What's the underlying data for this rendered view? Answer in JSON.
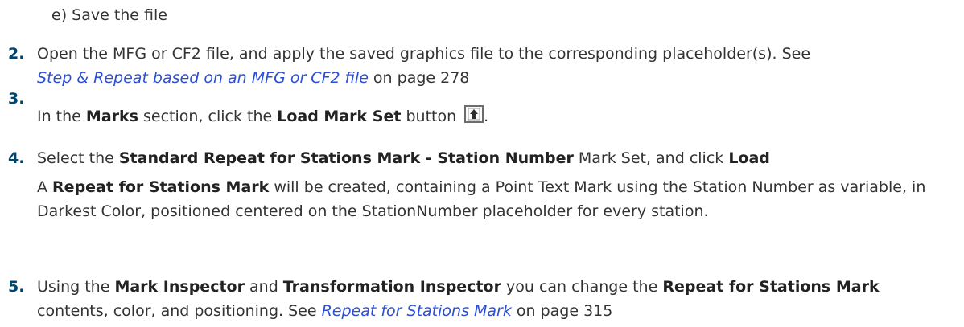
{
  "sub_item": "e)  Save the file",
  "steps": [
    {
      "num": "2.",
      "text1": "Open the MFG or CF2 file, and apply the saved graphics file to the corresponding placeholder(s). See",
      "link": "Step & Repeat based on an MFG or CF2 file",
      "text2": " on page 278"
    },
    {
      "num": "3.",
      "t1": "In the ",
      "b1": "Marks",
      "t2": " section, click the ",
      "b2": "Load Mark Set",
      "t3": " button ",
      "icon": "upload-icon",
      "t4": "."
    },
    {
      "num": "4.",
      "t1": "Select the ",
      "b1": "Standard Repeat for Stations Mark - Station Number",
      "t2": " Mark Set, and click ",
      "b2": "Load",
      "p2_t1": "A ",
      "p2_b1": "Repeat for Stations Mark",
      "p2_t2": " will be created, containing a Point Text Mark using the Station Number as variable, in Darkest Color, positioned centered on the StationNumber placeholder for every station."
    },
    {
      "num": "5.",
      "t1": "Using the ",
      "b1": "Mark Inspector",
      "t2": " and ",
      "b2": "Transformation Inspector",
      "t3": " you can change the ",
      "b3": "Repeat for Stations Mark",
      "t4": " contents, color, and positioning. See ",
      "link": "Repeat for Stations Mark",
      "t5": " on page 315"
    }
  ]
}
